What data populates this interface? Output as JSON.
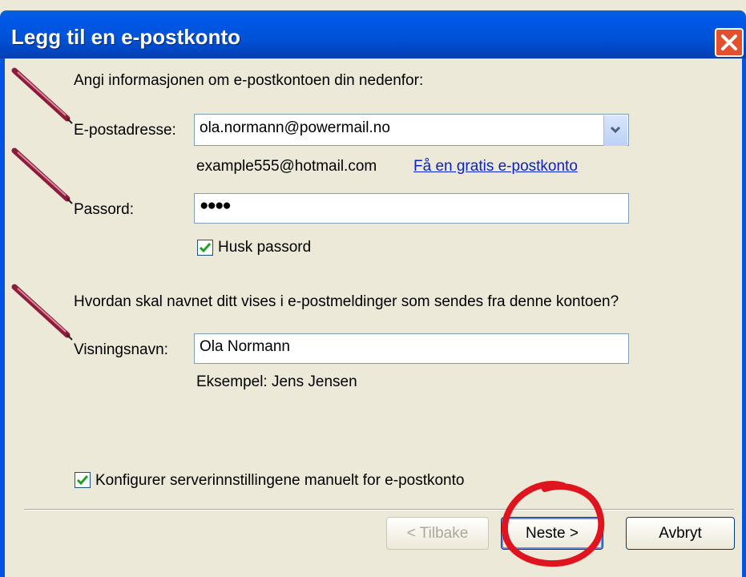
{
  "window": {
    "title": "Legg til en e-postkonto",
    "close_label": "×"
  },
  "intro": "Angi informasjonen om e-postkontoen din nedenfor:",
  "email": {
    "label": "E-postadresse:",
    "value": "ola.normann@powermail.no",
    "example": "example555@hotmail.com",
    "free_link": "Få en gratis e-postkonto"
  },
  "password": {
    "label": "Passord:",
    "value": "●●●●",
    "remember_label": "Husk passord",
    "remember_checked": true
  },
  "display": {
    "question": "Hvordan skal navnet ditt vises i e-postmeldinger som sendes fra denne kontoen?",
    "label": "Visningsnavn:",
    "value": "Ola Normann",
    "example": "Eksempel: Jens Jensen"
  },
  "manual": {
    "label": "Konfigurer serverinnstillingene manuelt for e-postkonto",
    "checked": true
  },
  "buttons": {
    "back": "< Tilbake",
    "next": "Neste >",
    "cancel": "Avbryt"
  },
  "annotations": {
    "pen_color": "#8c1c3a",
    "circle_color": "#e0141e"
  }
}
